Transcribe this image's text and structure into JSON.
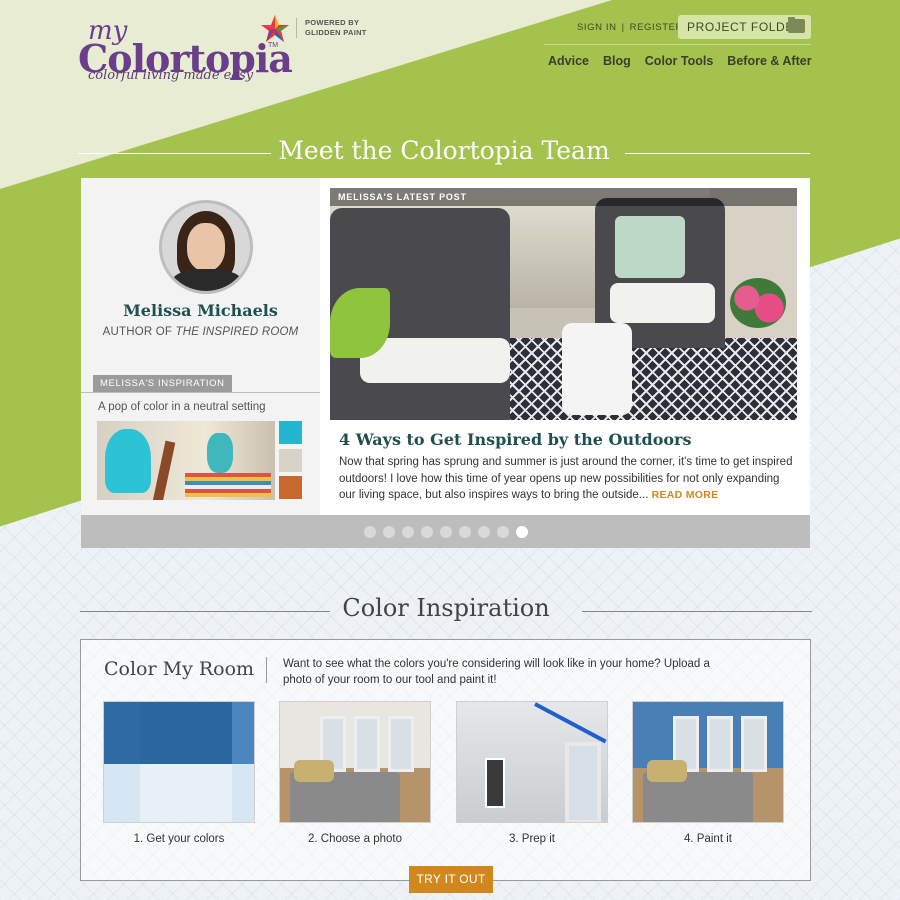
{
  "brand": {
    "logo_my": "my",
    "logo_main": "Colortopia",
    "logo_tm": "TM",
    "tagline": "colorful living made easy",
    "powered_by": "POWERED BY",
    "powered_brand": "GLIDDEN PAINT"
  },
  "header": {
    "sign_in": "SIGN IN",
    "separator": "|",
    "register": "REGISTER",
    "project_folder": "PROJECT FOLDER",
    "nav": [
      "Advice",
      "Blog",
      "Color Tools",
      "Before & After"
    ]
  },
  "team": {
    "section_title": "Meet the Colortopia Team",
    "name": "Melissa Michaels",
    "role_prefix": "AUTHOR OF ",
    "role_book": "THE INSPIRED ROOM",
    "inspiration_tab": "MELISSA'S INSPIRATION",
    "inspiration_caption": "A pop of color in a neutral setting",
    "swatches": [
      "#23b6d0",
      "#d8d3c9",
      "#c7692f"
    ],
    "post_tag": "MELISSA'S LATEST POST",
    "post_title": "4 Ways to Get Inspired by the Outdoors",
    "post_body": "Now that spring has sprung and summer is just around the corner, it's time to get inspired outdoors! I love how this time of year opens up new possibilities for not only expanding our living space, but also inspires ways to bring the outside...",
    "read_more": "READ MORE",
    "carousel_count": 9,
    "carousel_active": 9
  },
  "inspiration": {
    "section_title": "Color Inspiration",
    "tool_title": "Color My Room",
    "tool_desc": "Want to see what the colors you're considering will look like in your home? Upload a photo of your room to our tool and paint it!",
    "steps": [
      "1. Get your colors",
      "2. Choose a photo",
      "3. Prep it",
      "4. Paint it"
    ],
    "cta": "TRY IT OUT"
  },
  "colors": {
    "green": "#a4c34e",
    "teal_heading": "#1f4f4f",
    "accent_orange": "#d1871e",
    "purple_logo": "#6b3e8c"
  }
}
